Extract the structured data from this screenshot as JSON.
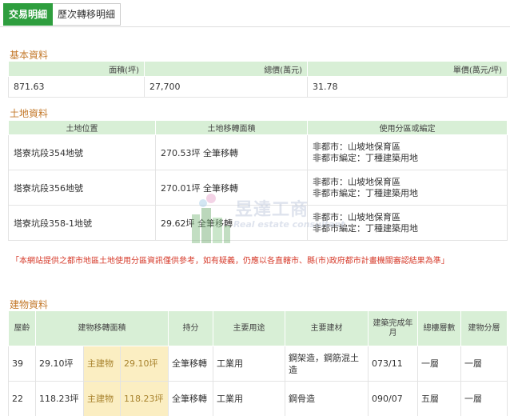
{
  "tabs": [
    {
      "label": "交易明細"
    },
    {
      "label": "歷次轉移明細"
    }
  ],
  "basic": {
    "title": "基本資料",
    "headers": [
      "面積(坪)",
      "總價(萬元)",
      "單價(萬元/坪)"
    ],
    "values": [
      "871.63",
      "27,700",
      "31.78"
    ]
  },
  "land": {
    "title": "土地資料",
    "headers": [
      "土地位置",
      "土地移轉面積",
      "使用分區或編定"
    ],
    "rows": [
      {
        "location": "塔寮坑段354地號",
        "area": "270.53坪 全筆移轉",
        "zone1": "非都市：山坡地保育區",
        "zone2": "非都市編定：丁種建築用地"
      },
      {
        "location": "塔寮坑段356地號",
        "area": "270.01坪 全筆移轉",
        "zone1": "非都市：山坡地保育區",
        "zone2": "非都市編定：丁種建築用地"
      },
      {
        "location": "塔寮坑段358-1地號",
        "area": "29.62坪 全筆移轉",
        "zone1": "非都市：山坡地保育區",
        "zone2": "非都市編定：丁種建築用地"
      }
    ]
  },
  "notice": "「本網站提供之都市地區土地使用分區資訊僅供參考，如有疑義，仍應以各直轄市、縣(市)政府都市計畫機關審認結果為準」",
  "building": {
    "title": "建物資料",
    "headers": [
      "屋齡",
      "建物移轉面積",
      "持分",
      "主要用途",
      "主要建材",
      "建築完成年月",
      "總樓層數",
      "建物分層"
    ],
    "rows": [
      {
        "age": "39",
        "area": "29.10坪",
        "type": "主建物",
        "type_area": "29.10坪",
        "share": "全筆移轉",
        "use": "工業用",
        "material": "鋼架造，鋼筋混土造",
        "completed": "073/11",
        "floors": "一層",
        "level": "一層"
      },
      {
        "age": "22",
        "area": "118.23坪",
        "type": "主建物",
        "type_area": "118.23坪",
        "share": "全筆移轉",
        "use": "工業用",
        "material": "鋼骨造",
        "completed": "090/07",
        "floors": "五層",
        "level": "一層"
      }
    ]
  },
  "watermark": {
    "text": "昱達工商",
    "sub": "Real estate consultant"
  },
  "colors": {
    "accent": "#2e9e3e",
    "section": "#c47a2c",
    "header_bg": "#d8efd6",
    "notice": "#d63b2b",
    "highlight": "#fbeec2"
  }
}
